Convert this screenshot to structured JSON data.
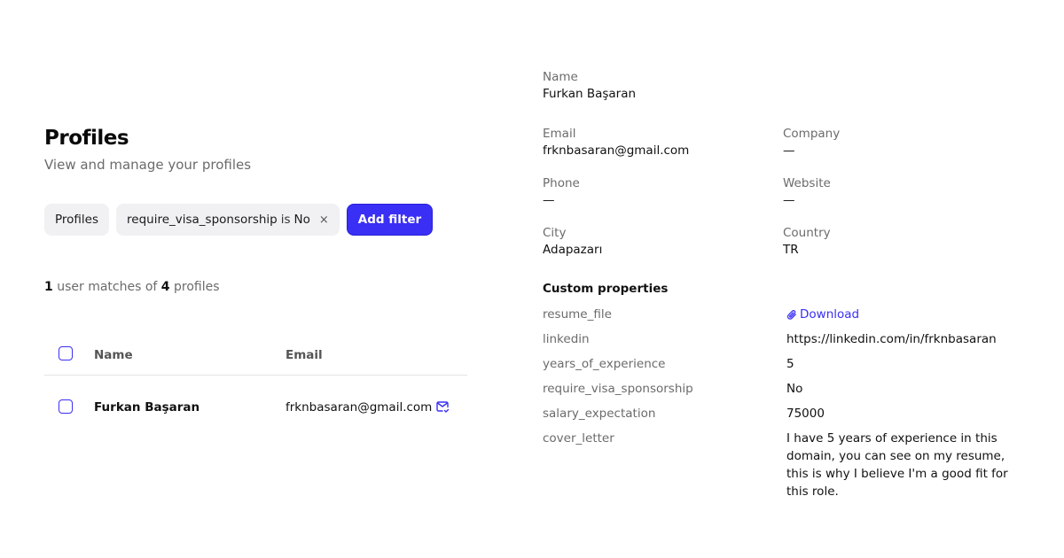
{
  "header": {
    "title": "Profiles",
    "subtitle": "View and manage your profiles"
  },
  "filters": {
    "scope_chip": "Profiles",
    "active_filter": {
      "field": "require_visa_sponsorship",
      "operator": "is",
      "value": "No",
      "remove_icon": "×"
    },
    "add_filter_label": "Add filter"
  },
  "summary": {
    "matched_count": "1",
    "middle_text": "user matches of",
    "total_count": "4",
    "suffix": "profiles"
  },
  "table": {
    "columns": [
      "Name",
      "Email"
    ],
    "rows": [
      {
        "name": "Furkan Başaran",
        "email": "frknbasaran@gmail.com"
      }
    ]
  },
  "detail": {
    "name_label": "Name",
    "name_value": "Furkan Başaran",
    "email_label": "Email",
    "email_value": "frknbasaran@gmail.com",
    "company_label": "Company",
    "company_value": "—",
    "phone_label": "Phone",
    "phone_value": "—",
    "website_label": "Website",
    "website_value": "—",
    "city_label": "City",
    "city_value": "Adapazarı",
    "country_label": "Country",
    "country_value": "TR",
    "custom_heading": "Custom properties",
    "custom_properties": [
      {
        "key": "resume_file",
        "value": "Download"
      },
      {
        "key": "linkedin",
        "value": "https://linkedin.com/in/frknbasaran"
      },
      {
        "key": "years_of_experience",
        "value": "5"
      },
      {
        "key": "require_visa_sponsorship",
        "value": "No"
      },
      {
        "key": "salary_expectation",
        "value": "75000"
      },
      {
        "key": "cover_letter",
        "value": "I have 5 years of experience in this domain, you can see on my resume, this is why I believe I'm a good fit for this role."
      }
    ]
  },
  "colors": {
    "accent": "#3a2ff5",
    "chip_background": "#f1f1f3",
    "muted_text": "#6b6b6b"
  },
  "icons": {
    "remove_filter": "close-icon",
    "row_action": "mail-check-icon",
    "download": "paperclip-icon"
  }
}
